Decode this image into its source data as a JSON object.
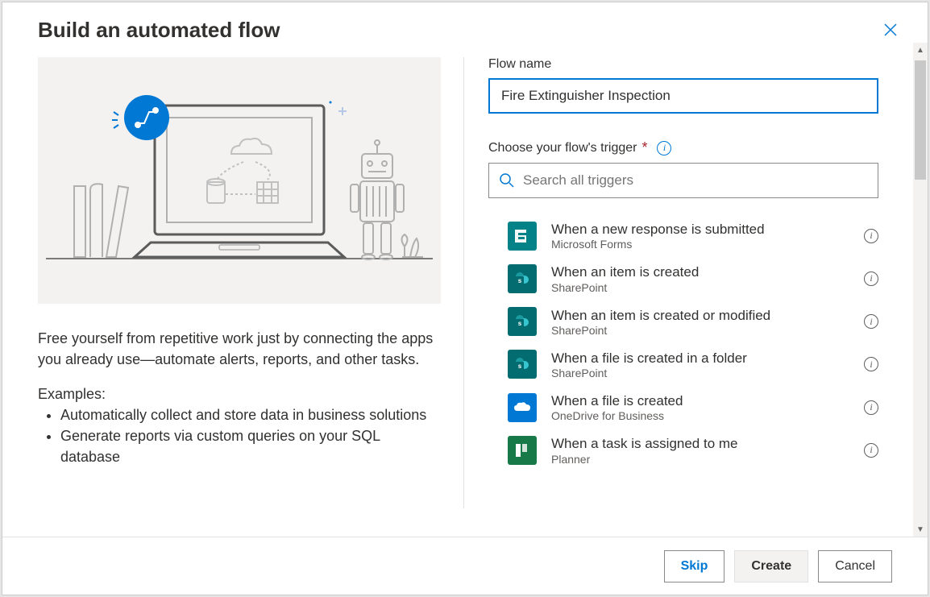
{
  "dialog": {
    "title": "Build an automated flow"
  },
  "left": {
    "description": "Free yourself from repetitive work just by connecting the apps you already use—automate alerts, reports, and other tasks.",
    "examples_heading": "Examples:",
    "examples": [
      "Automatically collect and store data in business solutions",
      "Generate reports via custom queries on your SQL database"
    ]
  },
  "form": {
    "flow_name_label": "Flow name",
    "flow_name_value": "Fire Extinguisher Inspection",
    "trigger_label": "Choose your flow's trigger",
    "search_placeholder": "Search all triggers"
  },
  "triggers": [
    {
      "icon": "forms",
      "title": "When a new response is submitted",
      "subtitle": "Microsoft Forms"
    },
    {
      "icon": "sharepoint",
      "title": "When an item is created",
      "subtitle": "SharePoint"
    },
    {
      "icon": "sharepoint",
      "title": "When an item is created or modified",
      "subtitle": "SharePoint"
    },
    {
      "icon": "sharepoint",
      "title": "When a file is created in a folder",
      "subtitle": "SharePoint"
    },
    {
      "icon": "onedrive",
      "title": "When a file is created",
      "subtitle": "OneDrive for Business"
    },
    {
      "icon": "planner",
      "title": "When a task is assigned to me",
      "subtitle": "Planner"
    }
  ],
  "footer": {
    "skip": "Skip",
    "create": "Create",
    "cancel": "Cancel"
  },
  "colors": {
    "primary": "#0078d4",
    "forms": "#038387",
    "sharepoint": "#036c70",
    "onedrive": "#0078d4",
    "planner": "#177848"
  }
}
